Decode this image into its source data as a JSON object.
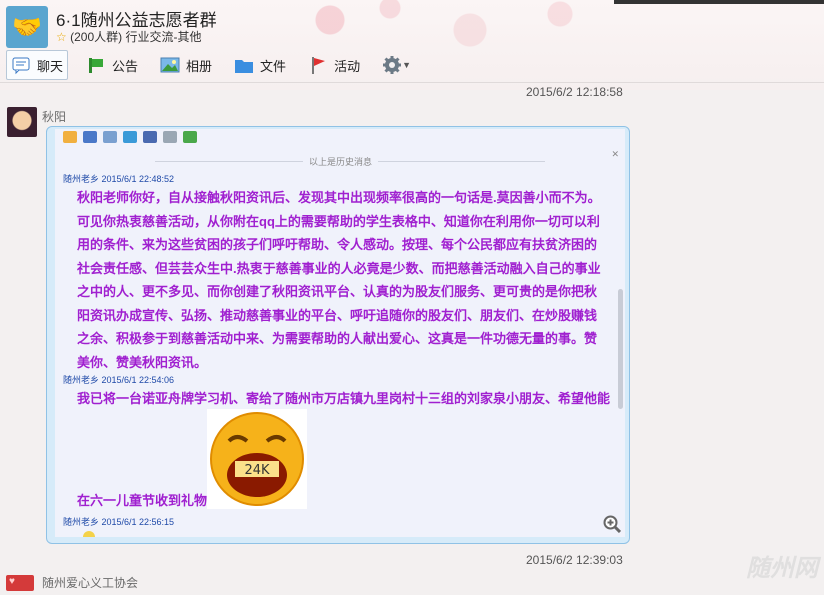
{
  "group": {
    "title": "6·1随州公益志愿者群",
    "subtitle": "(200人群) 行业交流-其他"
  },
  "toolbar": {
    "chat": "聊天",
    "notice": "公告",
    "album": "相册",
    "files": "文件",
    "activity": "活动"
  },
  "messages": [
    {
      "time": "2015/6/2 12:18:58",
      "sender": "秋阳"
    },
    {
      "time": "2015/6/2 12:39:03",
      "sender": "随州爱心义工协会"
    }
  ],
  "quoted": {
    "history_label": "以上是历史消息",
    "m1_meta": "随州老乡 2015/6/1 22:48:52",
    "m1_text": "秋阳老师你好，自从接触秋阳资讯后、发现其中出现频率很高的一句话是.莫因善小而不为。可见你热衷慈善活动，从你附在qq上的需要帮助的学生表格中、知道你在利用你一切可以利用的条件、来为这些贫困的孩子们呼吁帮助、令人感动。按理、每个公民都应有扶贫济困的社会责任感、但芸芸众生中.热衷于慈善事业的人必竟是少数、而把慈善活动融入自己的事业之中的人、更不多见、而你创建了秋阳资讯平台、认真的为股友们服务、更可贵的是你把秋阳资讯办成宣传、弘扬、推动慈善事业的平台、呼吁追随你的股友们、朋友们、在炒股赚钱之余、积极参于到慈善活动中来、为需要帮助的人献出爱心、这真是一件功德无量的事。赞美你、赞美秋阳资讯。",
    "m2_meta": "随州老乡 2015/6/1 22:54:06",
    "m2_text": "我已将一台诺亚舟牌学习机、寄给了随州市万店镇九里岗村十三组的刘家泉小朋友、希望他能",
    "m2_text_end": "在六一儿童节收到礼物",
    "smiley_text": "24K",
    "m3_meta": "随州老乡 2015/6/1 22:56:15"
  },
  "watermark": "随州网"
}
